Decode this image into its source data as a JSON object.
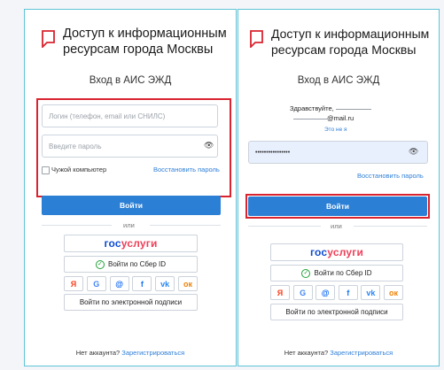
{
  "left": {
    "title_line1": "Доступ к информационным",
    "title_line2": "ресурсам города Москвы",
    "subtitle": "Вход в АИС ЭЖД",
    "login_placeholder": "Логин (телефон, email или СНИЛС)",
    "password_placeholder": "Введите пароль",
    "foreign_pc": "Чужой компьютер",
    "restore": "Восстановить пароль",
    "login_button": "Войти",
    "or": "или",
    "gosuslugi_a": "гос",
    "gosuslugi_b": "услуги",
    "sber": "Войти по Сбер ID",
    "esign": "Войти по электронной подписи",
    "no_account": "Нет аккаунта?",
    "register": "Зарегистрироваться"
  },
  "right": {
    "title_line1": "Доступ к информационным",
    "title_line2": "ресурсам города Москвы",
    "subtitle": "Вход в АИС ЭЖД",
    "greeting": "Здравствуйте,",
    "email_suffix": "@mail.ru",
    "not_me": "Это не я",
    "password_dots": "••••••••••••••••",
    "restore": "Восстановить пароль",
    "login_button": "Войти",
    "or": "или",
    "gosuslugi_a": "гос",
    "gosuslugi_b": "услуги",
    "sber": "Войти по Сбер ID",
    "esign": "Войти по электронной подписи",
    "no_account": "Нет аккаунта?",
    "register": "Зарегистрироваться"
  },
  "social_icons": [
    {
      "name": "yandex-icon",
      "glyph": "Я",
      "color": "#fc3f1d"
    },
    {
      "name": "google-icon",
      "glyph": "G",
      "color": "#4285f4"
    },
    {
      "name": "mailru-icon",
      "glyph": "@",
      "color": "#005ff9"
    },
    {
      "name": "facebook-icon",
      "glyph": "f",
      "color": "#1877f2"
    },
    {
      "name": "vk-icon",
      "glyph": "vk",
      "color": "#2787f5"
    },
    {
      "name": "odnoklassniki-icon",
      "glyph": "ок",
      "color": "#ee8208"
    }
  ],
  "colors": {
    "accent": "#2b7fd4",
    "highlight": "#d9242f",
    "panel_border": "#5ec4d8"
  }
}
